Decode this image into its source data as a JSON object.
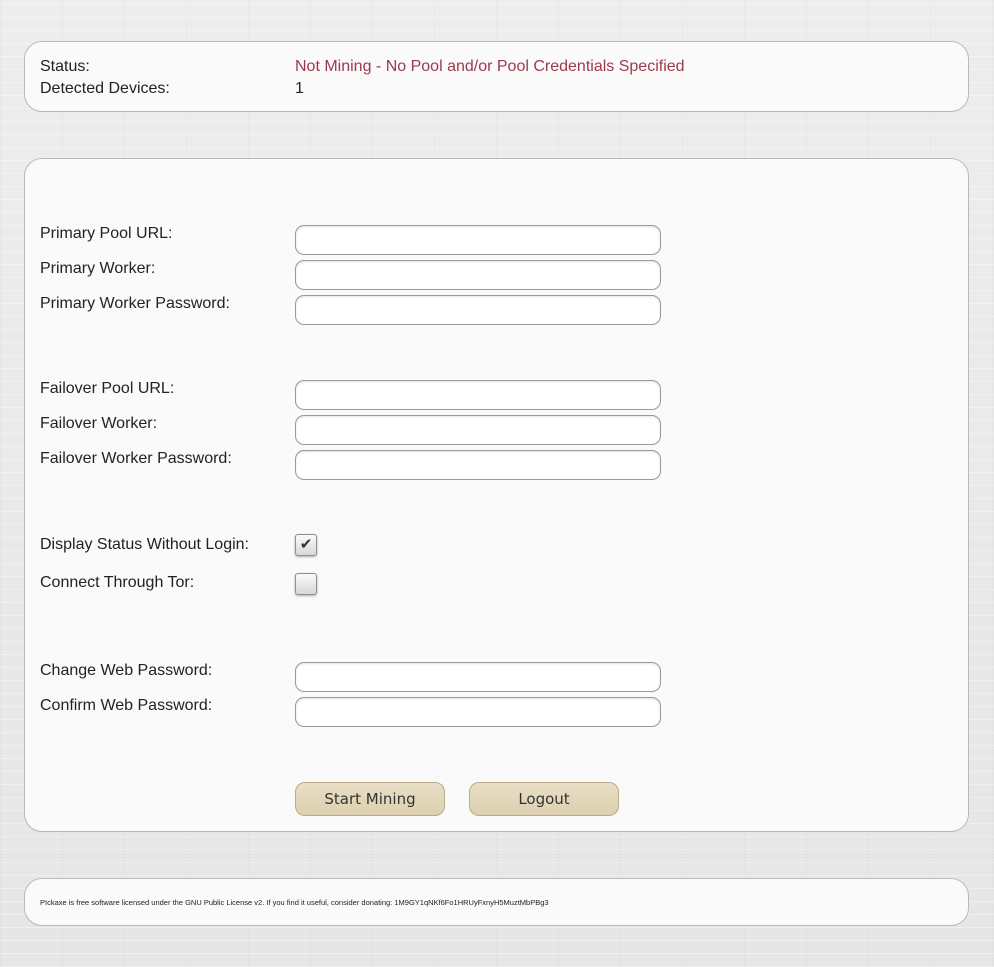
{
  "status_panel": {
    "status_label": "Status:",
    "status_value": "Not Mining - No Pool and/or Pool Credentials Specified",
    "devices_label": "Detected Devices:",
    "devices_value": "1"
  },
  "config": {
    "primary_pool_url_label": "Primary Pool URL:",
    "primary_pool_url_value": "",
    "primary_worker_label": "Primary Worker:",
    "primary_worker_value": "",
    "primary_worker_password_label": "Primary Worker Password:",
    "primary_worker_password_value": "",
    "failover_pool_url_label": "Failover Pool URL:",
    "failover_pool_url_value": "",
    "failover_worker_label": "Failover Worker:",
    "failover_worker_value": "",
    "failover_worker_password_label": "Failover Worker Password:",
    "failover_worker_password_value": "",
    "display_status_label": "Display Status Without Login:",
    "display_status_checked": true,
    "connect_tor_label": "Connect Through Tor:",
    "connect_tor_checked": false,
    "change_web_password_label": "Change Web Password:",
    "change_web_password_value": "",
    "confirm_web_password_label": "Confirm Web Password:",
    "confirm_web_password_value": ""
  },
  "buttons": {
    "start_mining": "Start Mining",
    "logout": "Logout"
  },
  "footer": {
    "text": "PIckaxe is free software licensed under the GNU Public License v2. If you find it useful, consider donating: 1M9GY1qNKf6Fo1HRUyFxnyH5MuztMbPBg3"
  },
  "colors": {
    "status_text": "#9b3a4f",
    "button_bg": "#e3d8bc",
    "panel_bg": "#fafafa",
    "page_bg": "#eaeaea"
  }
}
